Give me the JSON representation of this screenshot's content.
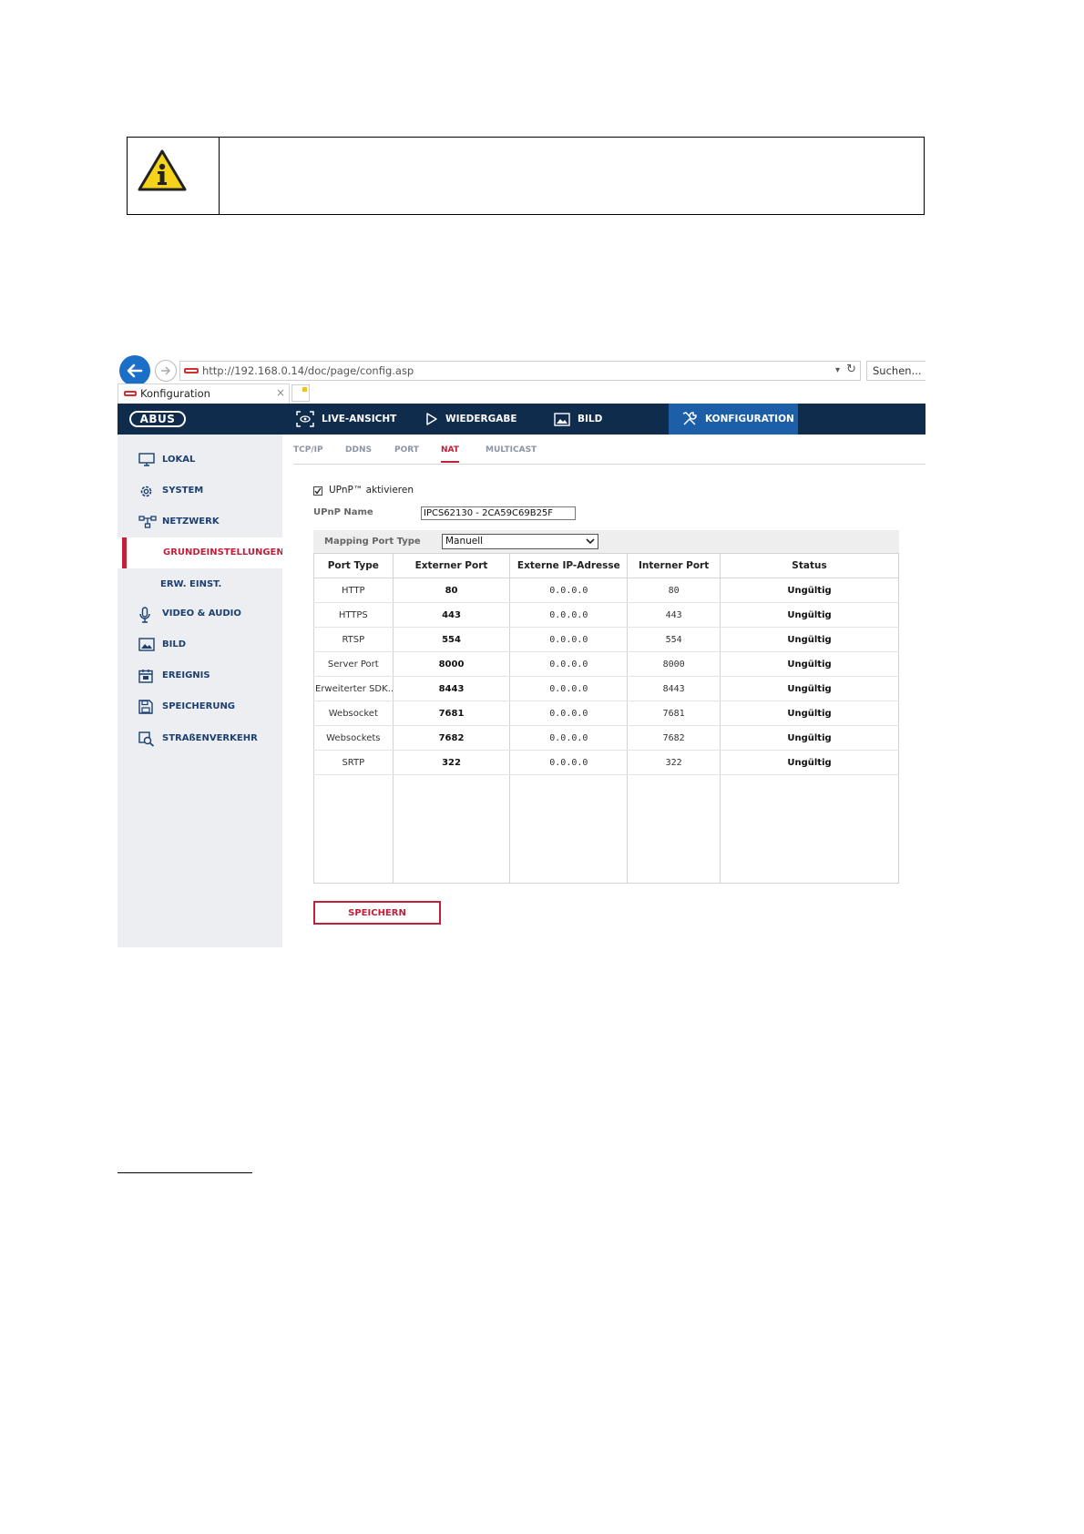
{
  "browser": {
    "url": "http://192.168.0.14/doc/page/config.asp",
    "search_placeholder": "Suchen...",
    "tab_title": "Konfiguration",
    "tab_close": "×",
    "dropdown_glyph": "▾",
    "reload_glyph": "↻"
  },
  "topnav": {
    "logo": "ABUS",
    "items": [
      {
        "label": "LIVE-ANSICHT",
        "icon": "live-view-icon"
      },
      {
        "label": "WIEDERGABE",
        "icon": "play-icon"
      },
      {
        "label": "BILD",
        "icon": "image-icon"
      },
      {
        "label": "KONFIGURATION",
        "icon": "tools-icon",
        "active": true
      }
    ]
  },
  "sidebar": {
    "items": [
      {
        "label": "LOKAL",
        "icon": "monitor-icon"
      },
      {
        "label": "SYSTEM",
        "icon": "gear-icon"
      },
      {
        "label": "NETZWERK",
        "icon": "network-icon"
      },
      {
        "label": "GRUNDEINSTELLUNGEN",
        "active": true
      },
      {
        "label": "ERW. EINST."
      },
      {
        "label": "VIDEO & AUDIO",
        "icon": "microphone-icon"
      },
      {
        "label": "BILD",
        "icon": "picture-icon"
      },
      {
        "label": "EREIGNIS",
        "icon": "calendar-icon"
      },
      {
        "label": "SPEICHERUNG",
        "icon": "floppy-icon"
      },
      {
        "label": "STRAßENVERKEHR",
        "icon": "traffic-search-icon"
      }
    ]
  },
  "subtabs": [
    {
      "label": "TCP/IP"
    },
    {
      "label": "DDNS"
    },
    {
      "label": "PORT"
    },
    {
      "label": "NAT",
      "active": true
    },
    {
      "label": "MULTICAST"
    }
  ],
  "nat": {
    "upnp_enabled": true,
    "upnp_checkbox_label": "UPnP™ aktivieren",
    "upnp_name_label": "UPnP Name",
    "upnp_name_value": "IPCS62130 - 2CA59C69B25F",
    "mapping_label": "Mapping Port Type",
    "mapping_value": "Manuell"
  },
  "table": {
    "headers": [
      "Port Type",
      "Externer Port",
      "Externe IP-Adresse",
      "Interner Port",
      "Status"
    ],
    "rows": [
      [
        "HTTP",
        "80",
        "0.0.0.0",
        "80",
        "Ungültig"
      ],
      [
        "HTTPS",
        "443",
        "0.0.0.0",
        "443",
        "Ungültig"
      ],
      [
        "RTSP",
        "554",
        "0.0.0.0",
        "554",
        "Ungültig"
      ],
      [
        "Server Port",
        "8000",
        "0.0.0.0",
        "8000",
        "Ungültig"
      ],
      [
        "Erweiterter SDK...",
        "8443",
        "0.0.0.0",
        "8443",
        "Ungültig"
      ],
      [
        "Websocket",
        "7681",
        "0.0.0.0",
        "7681",
        "Ungültig"
      ],
      [
        "Websockets",
        "7682",
        "0.0.0.0",
        "7682",
        "Ungültig"
      ],
      [
        "SRTP",
        "322",
        "0.0.0.0",
        "322",
        "Ungültig"
      ]
    ]
  },
  "save_label": "SPEICHERN",
  "colors": {
    "nav_bg": "#0f2c4d",
    "nav_active": "#1c5fa8",
    "accent_red": "#c0213a",
    "sidebar_bg": "#eceef1"
  }
}
